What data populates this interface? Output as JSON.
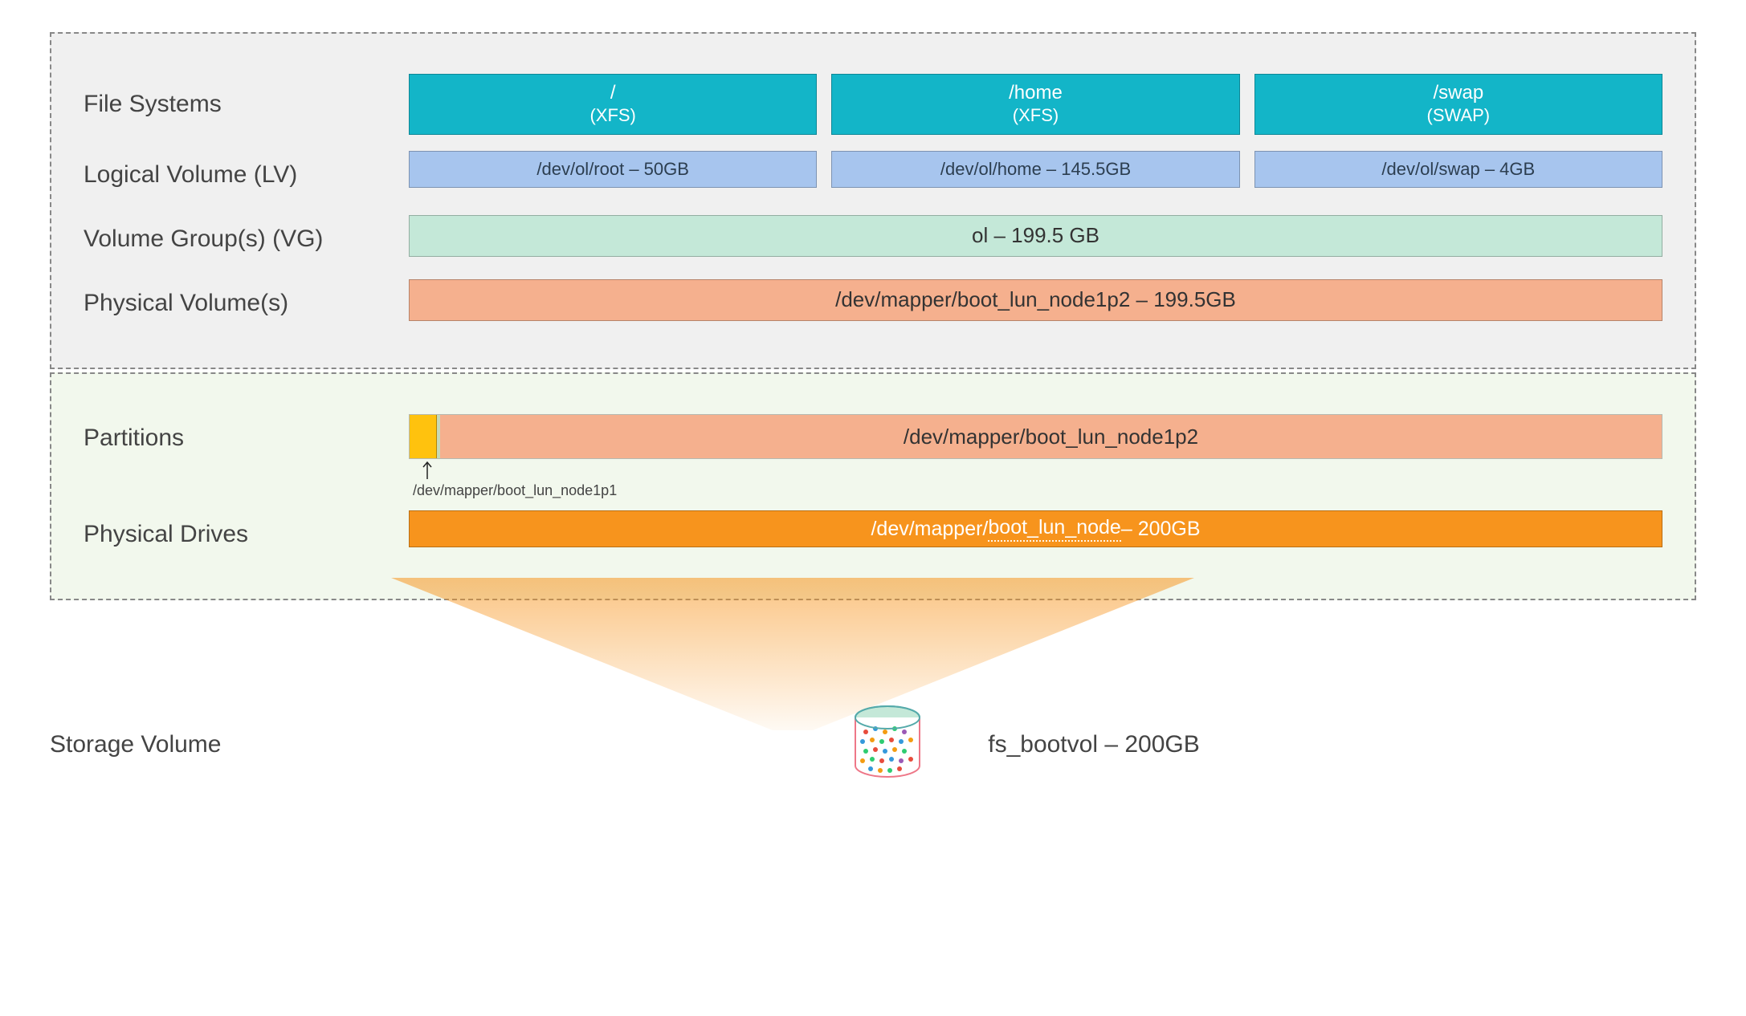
{
  "labels": {
    "file_systems": "File Systems",
    "logical_volume": "Logical Volume (LV)",
    "volume_groups": "Volume Group(s) (VG)",
    "physical_volumes": "Physical Volume(s)",
    "partitions": "Partitions",
    "physical_drives": "Physical Drives",
    "storage_volume": "Storage Volume"
  },
  "file_systems": [
    {
      "mount": "/",
      "type": "(XFS)"
    },
    {
      "mount": "/home",
      "type": "(XFS)"
    },
    {
      "mount": "/swap",
      "type": "(SWAP)"
    }
  ],
  "logical_volumes": [
    {
      "text": "/dev/ol/root – 50GB"
    },
    {
      "text": "/dev/ol/home – 145.5GB"
    },
    {
      "text": "/dev/ol/swap – 4GB"
    }
  ],
  "volume_group": {
    "text": "ol – 199.5 GB"
  },
  "physical_volume": {
    "text": "/dev/mapper/boot_lun_node1p2 – 199.5GB"
  },
  "partitions": {
    "p1_label": "/dev/mapper/boot_lun_node1p1",
    "p2_label": "/dev/mapper/boot_lun_node1p2"
  },
  "physical_drive": {
    "prefix": "/dev/mapper/",
    "mid": "boot_lun_node",
    "suffix": " – 200GB"
  },
  "storage_volume": {
    "text": "fs_bootvol – 200GB"
  },
  "colors": {
    "teal": "#13b5c8",
    "lblue": "#a7c5ee",
    "mint": "#c4e8d8",
    "salmon": "#f5b08e",
    "orange": "#f7941d",
    "yellow": "#ffc20e"
  }
}
